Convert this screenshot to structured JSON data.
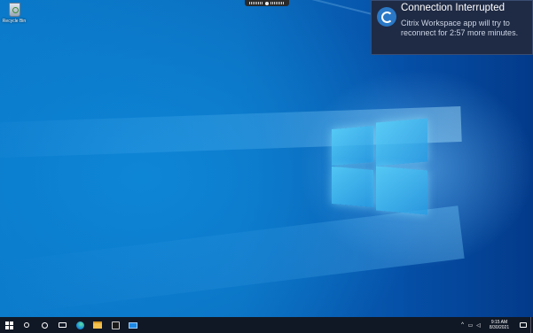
{
  "desktop": {
    "icons": [
      {
        "label": "Recycle Bin",
        "icon": "recycle-bin-icon"
      }
    ]
  },
  "citrix_toolbar": {
    "icon": "citrix-toolbar-handle-icon"
  },
  "notification": {
    "icon": "citrix-workspace-icon",
    "title": "Connection Interrupted",
    "body": "Citrix Workspace app will try to reconnect for 2:57 more minutes."
  },
  "taskbar": {
    "buttons": [
      {
        "name": "start",
        "icon": "windows-start-icon"
      },
      {
        "name": "search",
        "icon": "search-icon"
      },
      {
        "name": "cortana",
        "icon": "cortana-icon"
      },
      {
        "name": "task-view",
        "icon": "task-view-icon"
      },
      {
        "name": "edge",
        "icon": "edge-browser-icon"
      },
      {
        "name": "file-explorer",
        "icon": "file-explorer-icon"
      },
      {
        "name": "store",
        "icon": "microsoft-store-icon"
      },
      {
        "name": "mail",
        "icon": "mail-icon"
      }
    ],
    "tray": {
      "chevron": "^",
      "clock": {
        "time": "9:15 AM",
        "date": "8/30/2021"
      }
    }
  },
  "colors": {
    "taskbar_bg": "#101826",
    "notification_bg": "#1f2a44",
    "accent": "#2a78c6"
  }
}
